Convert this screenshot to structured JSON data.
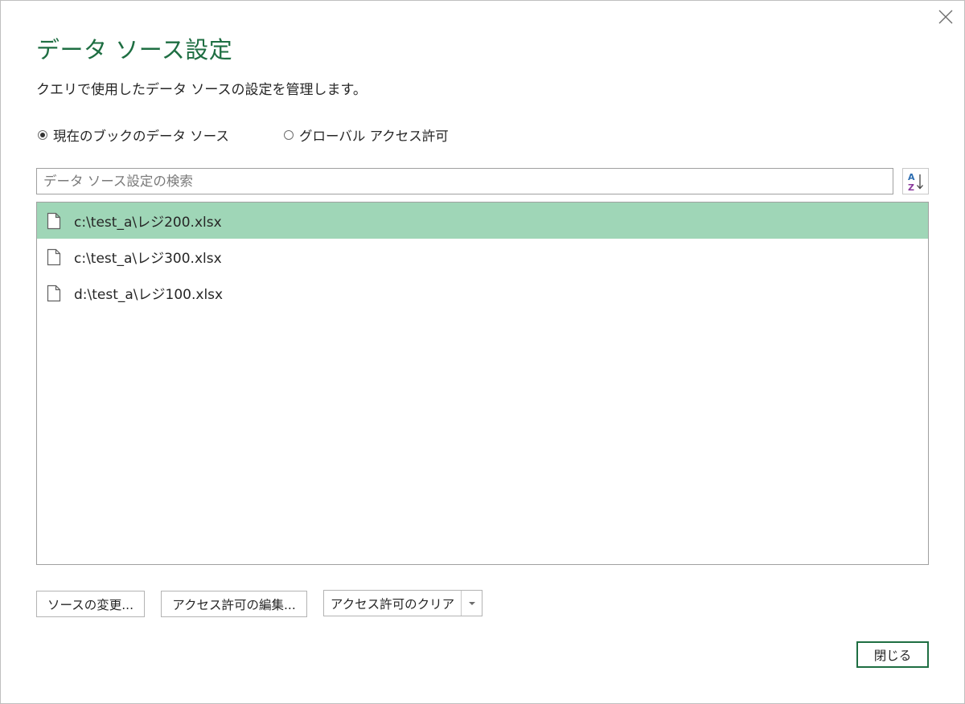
{
  "dialog": {
    "title": "データ ソース設定",
    "description": "クエリで使用したデータ ソースの設定を管理します。",
    "close_icon": "close-icon"
  },
  "scope": {
    "options": [
      {
        "label": "現在のブックのデータ ソース",
        "checked": true
      },
      {
        "label": "グローバル アクセス許可",
        "checked": false
      }
    ]
  },
  "search": {
    "placeholder": "データ ソース設定の検索",
    "value": "",
    "sort_icon": "sort-az-icon"
  },
  "sources": {
    "items": [
      {
        "label": "c:\\test_a\\レジ200.xlsx",
        "icon": "file-icon",
        "selected": true
      },
      {
        "label": "c:\\test_a\\レジ300.xlsx",
        "icon": "file-icon",
        "selected": false
      },
      {
        "label": "d:\\test_a\\レジ100.xlsx",
        "icon": "file-icon",
        "selected": false
      }
    ]
  },
  "actions": {
    "change_source": "ソースの変更...",
    "edit_permissions": "アクセス許可の編集...",
    "clear_permissions": "アクセス許可のクリア",
    "close": "閉じる"
  },
  "colors": {
    "accent": "#1e6e42",
    "selection": "#9fd6b7"
  }
}
